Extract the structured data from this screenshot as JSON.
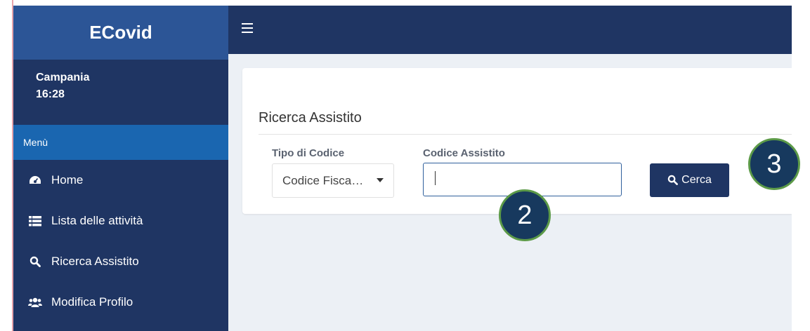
{
  "app": {
    "brand": "ECovid"
  },
  "user": {
    "region": "Campania",
    "time": "16:28"
  },
  "sidebar": {
    "menu_header": "Menù",
    "items": [
      {
        "label": "Home",
        "icon": "dashboard-icon"
      },
      {
        "label": "Lista delle attività",
        "icon": "list-icon"
      },
      {
        "label": "Ricerca Assistito",
        "icon": "search-icon"
      },
      {
        "label": "Modifica Profilo",
        "icon": "users-icon"
      }
    ]
  },
  "search": {
    "title": "Ricerca Assistito",
    "code_type_label": "Tipo di Codice",
    "code_type_value": "Codice Fisca…",
    "code_label": "Codice Assistito",
    "code_value": "",
    "button_label": "Cerca"
  },
  "annotations": {
    "step_2": "2",
    "step_3": "3"
  },
  "colors": {
    "sidebar": "#1f3563",
    "brand": "#2c5596",
    "menu_header": "#1a66b0",
    "content_bg": "#ecf0f5",
    "badge_ring": "#5c9a48"
  }
}
